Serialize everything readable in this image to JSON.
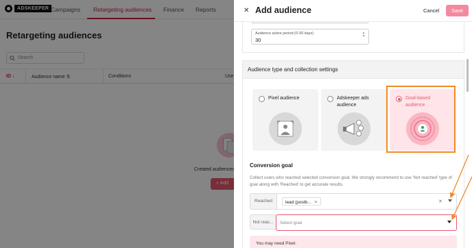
{
  "brand": {
    "logo_text": "ADSKEEPER"
  },
  "topnav": {
    "tabs": [
      {
        "label": "Campaigns"
      },
      {
        "label": "Retargeting audiences"
      },
      {
        "label": "Finance"
      },
      {
        "label": "Reports"
      }
    ]
  },
  "page": {
    "title": "Retargeting audiences",
    "search_placeholder": "Search",
    "table_headers": {
      "id": "ID ↓",
      "audience_name": "Audience name ⇅",
      "conditions": "Conditions",
      "used": "Use"
    },
    "empty_text": "Created audiences v",
    "add_button": "+ Add"
  },
  "drawer": {
    "title": "Add audience",
    "cancel_label": "Cancel",
    "save_label": "Save",
    "period_field": {
      "label": "Audience active period (0-30 days)",
      "value": "30"
    },
    "section_title": "Audience type and collection settings",
    "options": [
      {
        "label": "Pixel audience",
        "selected": false,
        "icon": "image-frame-icon"
      },
      {
        "label": "Adskeeper ads audience",
        "selected": false,
        "icon": "megaphone-icon"
      },
      {
        "label": "Goal-based audience",
        "selected": true,
        "icon": "target-user-icon"
      }
    ],
    "conversion_goal": {
      "title": "Conversion goal",
      "description": "Collect users who reached selected conversion goal. We strongly recommend to use 'Not reached' type of goal along with 'Reached' to get accurate results.",
      "reached_label": "Reached",
      "reached_chip": "lead (postb...",
      "not_reached_label": "Not reac...",
      "not_reached_placeholder": "Select goal"
    },
    "pixel_warning": "You may need Pixel."
  },
  "colors": {
    "accent": "#e8566e",
    "nav_active": "#c8213f",
    "annotation": "#f08a24"
  }
}
